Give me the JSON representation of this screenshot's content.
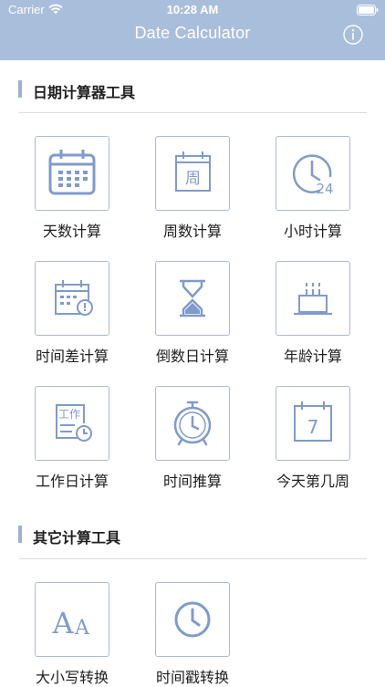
{
  "status_bar": {
    "carrier": "Carrier",
    "time": "10:28 AM"
  },
  "nav": {
    "title": "Date Calculator",
    "info_icon": "info-circle-icon"
  },
  "colors": {
    "header": "#a9bedb",
    "accent": "#9db1d3",
    "icon": "#7f9bcc",
    "tile_border": "#aabbd6"
  },
  "sections": [
    {
      "title": "日期计算器工具",
      "tools": [
        {
          "label": "天数计算",
          "icon": "calendar-grid-icon"
        },
        {
          "label": "周数计算",
          "icon": "calendar-week-icon"
        },
        {
          "label": "小时计算",
          "icon": "clock-24-icon"
        },
        {
          "label": "时间差计算",
          "icon": "calendar-clock-icon"
        },
        {
          "label": "倒数日计算",
          "icon": "hourglass-icon"
        },
        {
          "label": "年龄计算",
          "icon": "birthday-cake-icon"
        },
        {
          "label": "工作日计算",
          "icon": "work-calendar-icon",
          "icon_text": "工作"
        },
        {
          "label": "时间推算",
          "icon": "alarm-clock-icon"
        },
        {
          "label": "今天第几周",
          "icon": "calendar-day-icon",
          "icon_text": "7"
        }
      ]
    },
    {
      "title": "其它计算工具",
      "tools": [
        {
          "label": "大小写转换",
          "icon": "letter-case-icon",
          "icon_text": "AA"
        },
        {
          "label": "时间戳转换",
          "icon": "clock-icon"
        }
      ]
    }
  ]
}
